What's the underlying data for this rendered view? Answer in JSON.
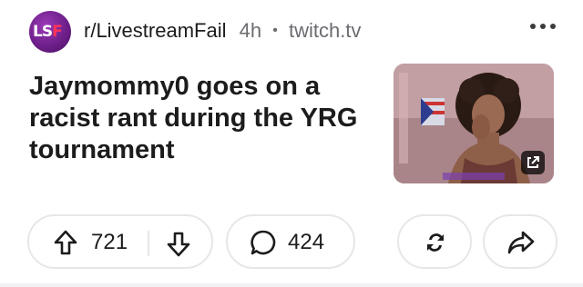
{
  "post": {
    "subreddit": "r/LivestreamFail",
    "avatar_text_a": "LS",
    "avatar_text_b": "F",
    "time": "4h",
    "separator": "•",
    "domain": "twitch.tv",
    "title": "Jaymommy0 goes on a racist rant during the YRG tournament"
  },
  "actions": {
    "upvotes": "721",
    "comments": "424"
  },
  "icons": {
    "more": "more-horizontal-icon",
    "upvote": "arrow-up-icon",
    "downvote": "arrow-down-icon",
    "comment": "comment-bubble-icon",
    "award": "award-swap-icon",
    "share": "share-arrow-icon",
    "external_link": "external-link-icon"
  },
  "colors": {
    "text": "#1c1c1c",
    "meta": "#6a6c70",
    "pill_border": "#e6e7e9",
    "avatar": "#6a1d86",
    "avatar_accent": "#ff3355"
  }
}
